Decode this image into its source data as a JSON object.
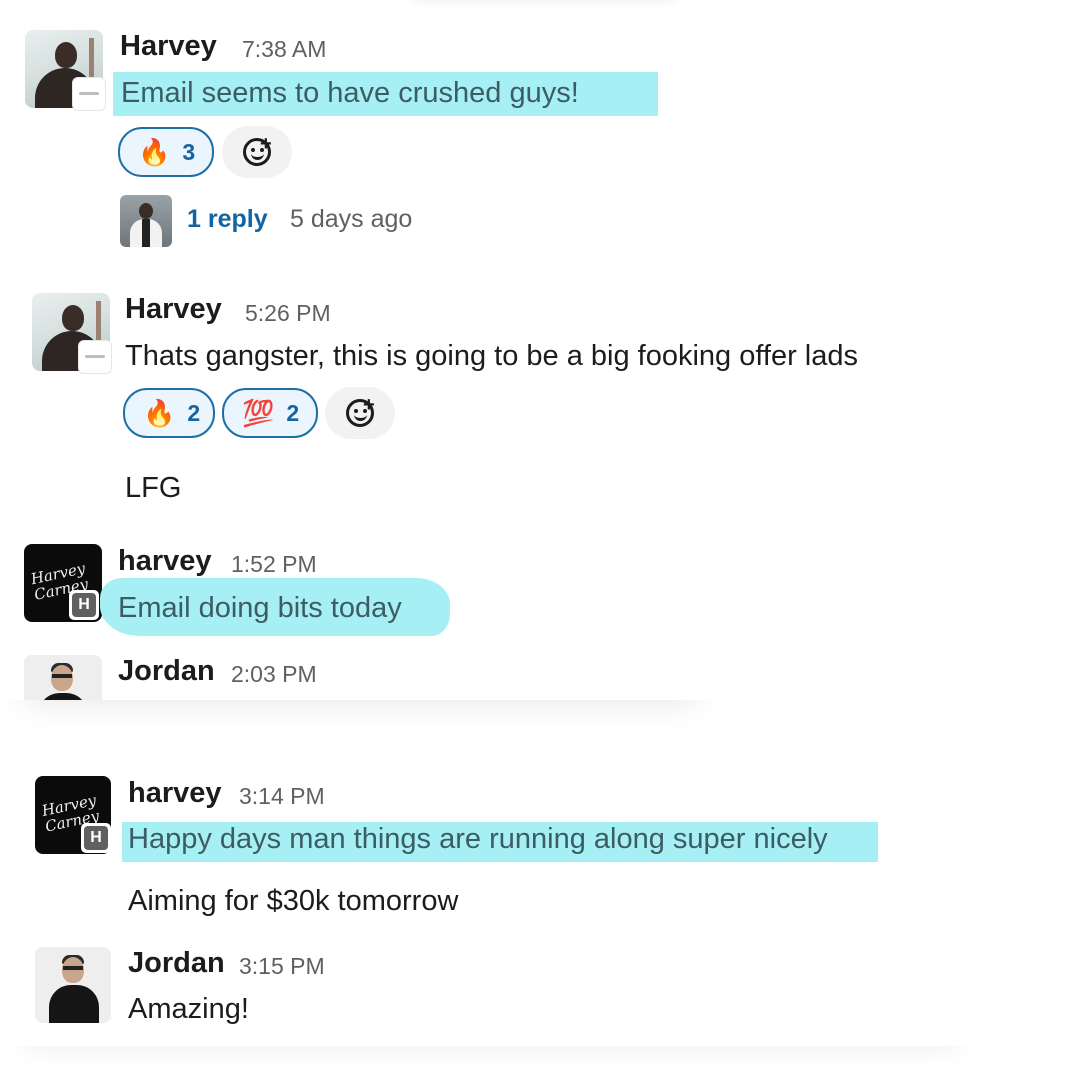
{
  "messages": [
    {
      "author": "Harvey",
      "time": "7:38 AM",
      "text": "Email seems to have crushed guys!",
      "reactions": [
        {
          "emoji": "🔥",
          "count": "3"
        }
      ],
      "add_reaction_icon": "add-emoji-icon",
      "thread": {
        "reply_label": "1 reply",
        "ago": "5 days ago"
      }
    },
    {
      "author": "Harvey",
      "time": "5:26 PM",
      "text": "Thats gangster, this is going to be a big fooking offer lads",
      "reactions": [
        {
          "emoji": "🔥",
          "count": "2"
        },
        {
          "emoji": "💯",
          "count": "2"
        }
      ],
      "add_reaction_icon": "add-emoji-icon",
      "followup": "LFG"
    },
    {
      "author": "harvey",
      "time": "1:52 PM",
      "text": "Email doing bits today",
      "avatar_script": "Harvey Carney",
      "badge_letter": "H"
    },
    {
      "author": "Jordan",
      "time": "2:03 PM"
    },
    {
      "author": "harvey",
      "time": "3:14 PM",
      "text": "Happy days man things are running along super nicely",
      "avatar_script": "Harvey Carney",
      "badge_letter": "H",
      "followup": "Aiming for $30k tomorrow"
    },
    {
      "author": "Jordan",
      "time": "3:15 PM",
      "text": "Amazing!"
    }
  ],
  "colors": {
    "highlight": "#a6eff5",
    "link": "#1264a3",
    "reaction_border": "#1d6fa5",
    "reaction_bg": "#eaf5fd"
  }
}
